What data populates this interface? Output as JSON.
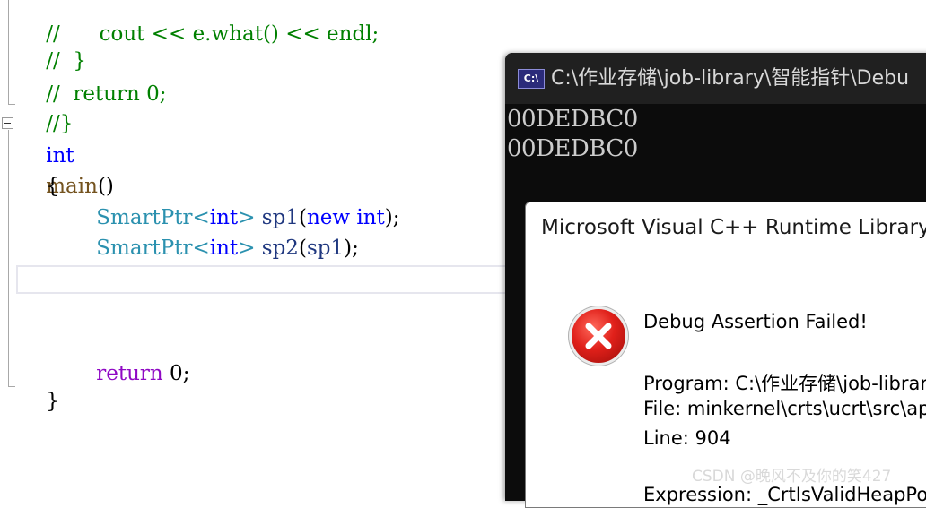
{
  "editor": {
    "lines": {
      "l0": {
        "comment": "//      cout << e.what() << endl;"
      },
      "l1": {
        "comment": "//  }"
      },
      "l2": {
        "comment": "//  return 0;"
      },
      "l3": {
        "comment": "//}"
      },
      "l4": {
        "kw": "int",
        "fn": "main",
        "rest": "()"
      },
      "l5": {
        "brace": "{"
      },
      "l6": {
        "type": "SmartPtr",
        "lt": "<",
        "kw": "int",
        "gt": "> ",
        "var": "sp1",
        "op": "(",
        "kw2": "new",
        "sp": " ",
        "kw3": "int",
        "end": ");"
      },
      "l7": {
        "type": "SmartPtr",
        "lt": "<",
        "kw": "int",
        "gt": "> ",
        "var": "sp2",
        "op": "(",
        "arg": "sp1",
        "end": ");"
      },
      "l8": {
        "ctrl": "return",
        "num": " 0",
        "end": ";"
      },
      "l9": {
        "brace": "}"
      }
    }
  },
  "console": {
    "icon_text": "C:\\",
    "title": "C:\\作业存储\\job-library\\智能指针\\Debu",
    "output": [
      "00DEDBC0",
      "00DEDBC0"
    ]
  },
  "dialog": {
    "title": "Microsoft Visual C++ Runtime Library",
    "heading": "Debug Assertion Failed!",
    "program": "Program: C:\\作业存储\\job-library",
    "file": "File: minkernel\\crts\\ucrt\\src\\ap",
    "line": "Line: 904",
    "expression": "Expression: _CrtIsValidHeapPo"
  },
  "watermark": "CSDN @晚风不及你的笑427",
  "colors": {
    "comment": "#008000",
    "keyword": "#0000ff",
    "type": "#2b91af",
    "control": "#8f08c4",
    "console_bg": "#0c0c0c",
    "error": "#e0201a"
  }
}
